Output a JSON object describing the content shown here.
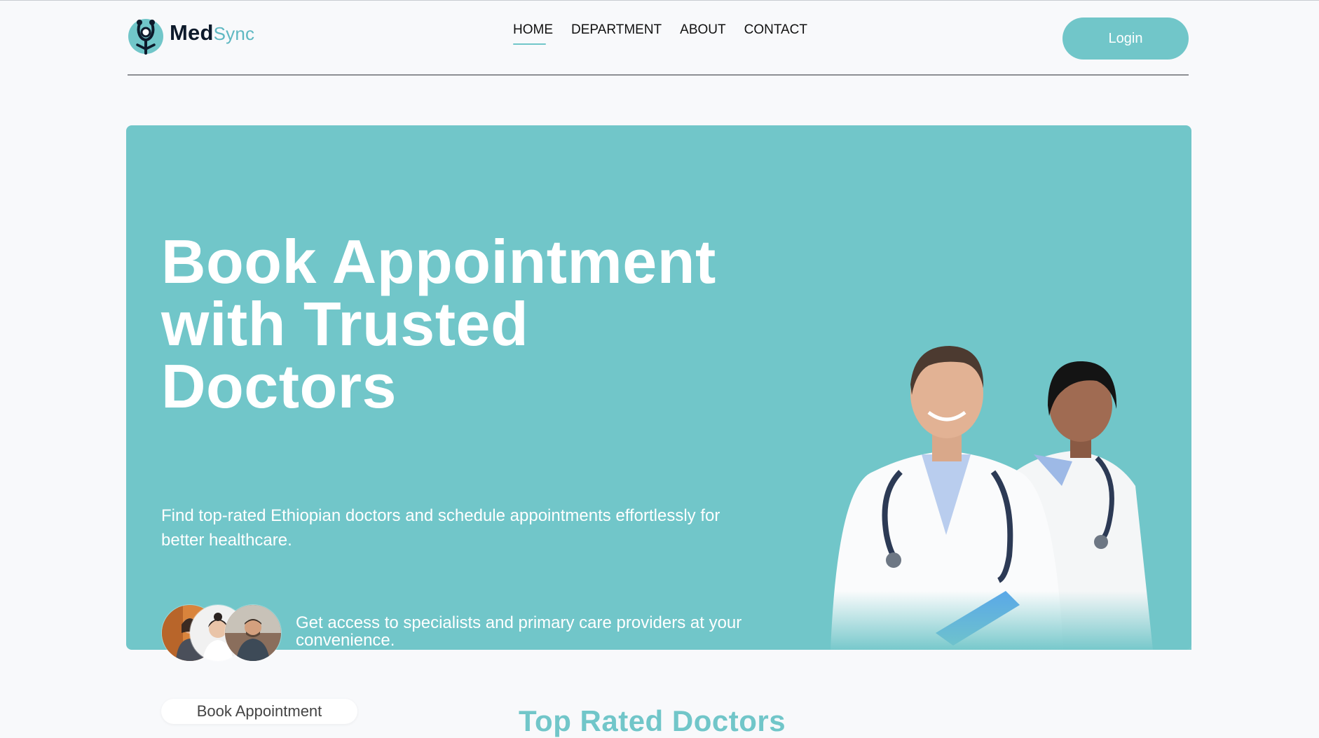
{
  "brand": {
    "name_bold": "Med",
    "name_light": "Sync",
    "accent": "#71c6c9",
    "logo_icon": "stethoscope-person-icon"
  },
  "nav": {
    "items": [
      {
        "label": "HOME",
        "active": true
      },
      {
        "label": "DEPARTMENT",
        "active": false
      },
      {
        "label": "ABOUT",
        "active": false
      },
      {
        "label": "CONTACT",
        "active": false
      }
    ]
  },
  "header": {
    "login_label": "Login"
  },
  "hero": {
    "background": "#71c6c9",
    "title_lines": [
      "Book Appointment",
      "with Trusted",
      "Doctors"
    ],
    "subtitle": "Find top-rated Ethiopian doctors and schedule appointments effortlessly for better healthcare.",
    "note": "Get access to specialists and primary care providers at your convenience.",
    "avatar_count": 3,
    "image": "two-doctors-in-white-coats"
  },
  "below": {
    "book_button_label": "Book Appointment",
    "section_title": "Top Rated Doctors"
  }
}
